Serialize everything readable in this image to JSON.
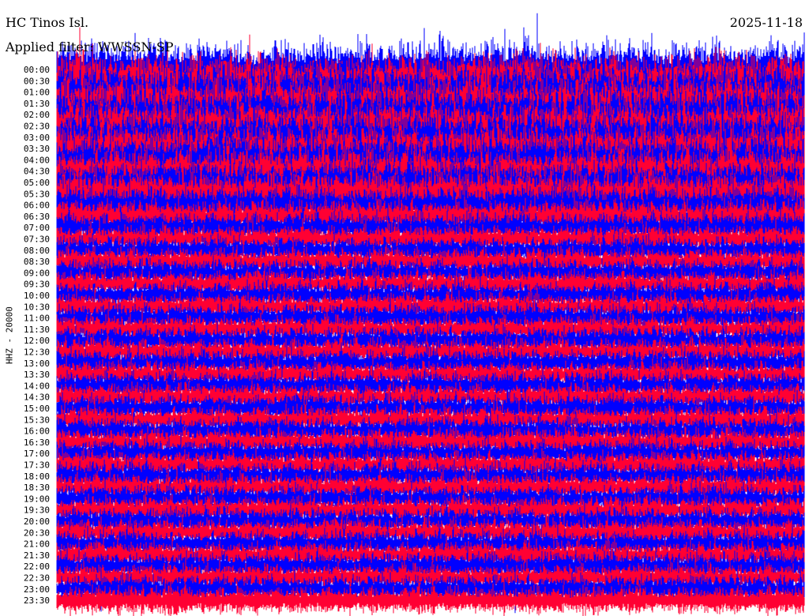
{
  "chart_data": {
    "type": "line",
    "title": "HC Tinos Isl.",
    "date": "2025-11-18",
    "filter_label": "Applied filter: WWSSN-SP",
    "ylabel": "HHZ - 20000",
    "row_labels": [
      "00:00",
      "00:30",
      "01:00",
      "01:30",
      "02:00",
      "02:30",
      "03:00",
      "03:30",
      "04:00",
      "04:30",
      "05:00",
      "05:30",
      "06:00",
      "06:30",
      "07:00",
      "07:30",
      "08:00",
      "08:30",
      "09:00",
      "09:30",
      "10:00",
      "10:30",
      "11:00",
      "11:30",
      "12:00",
      "12:30",
      "13:00",
      "13:30",
      "14:00",
      "14:30",
      "15:00",
      "15:30",
      "16:00",
      "16:30",
      "17:00",
      "17:30",
      "18:00",
      "18:30",
      "19:00",
      "19:30",
      "20:00",
      "20:30",
      "21:00",
      "21:30",
      "22:00",
      "22:30",
      "23:00",
      "23:30"
    ],
    "minutes_per_row": 30,
    "trace_colors": [
      "#0000ff",
      "#ff0033"
    ],
    "relative_amplitude": [
      1.0,
      1.0,
      1.0,
      1.0,
      1.0,
      0.95,
      0.95,
      0.9,
      0.9,
      0.85,
      0.8,
      0.8,
      0.7,
      0.6,
      0.55,
      0.5,
      0.5,
      0.5,
      0.5,
      0.5,
      0.5,
      0.5,
      0.5,
      0.5,
      0.5,
      0.5,
      0.5,
      0.5,
      0.5,
      0.5,
      0.5,
      0.5,
      0.5,
      0.5,
      0.5,
      0.5,
      0.5,
      0.5,
      0.5,
      0.5,
      0.5,
      0.5,
      0.5,
      0.5,
      0.5,
      0.5,
      0.5,
      0.5
    ]
  }
}
